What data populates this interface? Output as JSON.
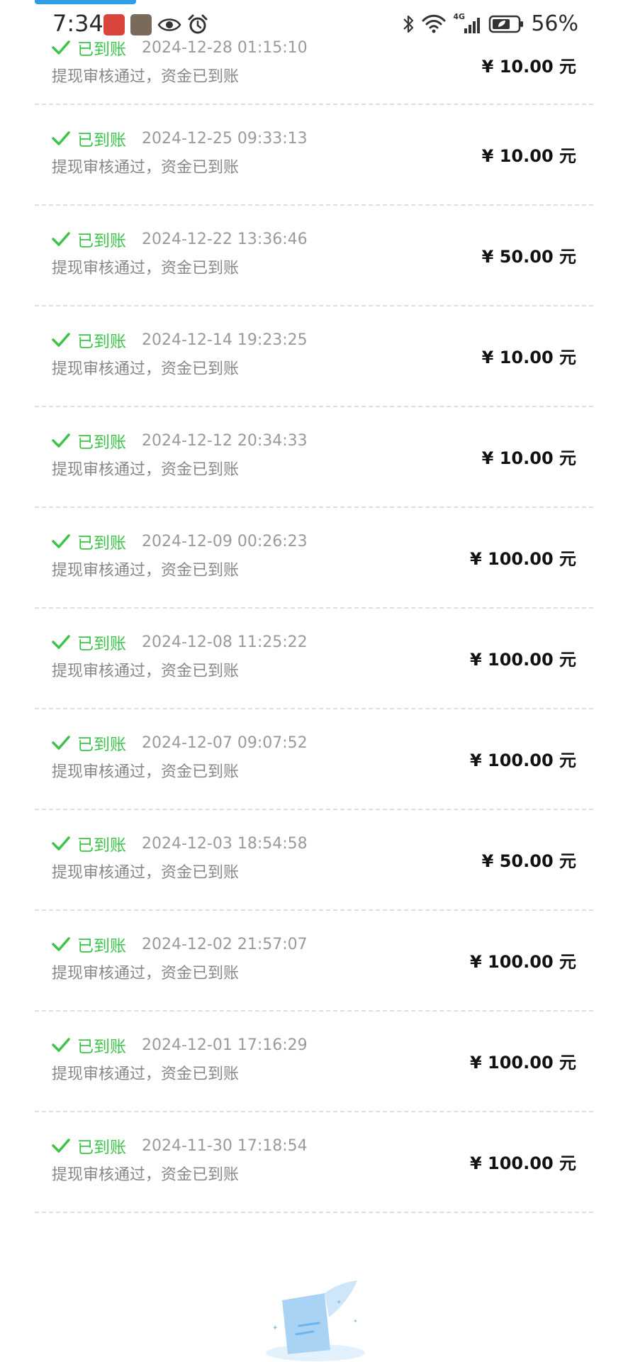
{
  "status_bar": {
    "time": "7:34",
    "battery": "56%",
    "network": "4G"
  },
  "icons": {
    "check": "checkmark-icon",
    "bluetooth": "bluetooth-icon",
    "wifi": "wifi-icon",
    "signal": "signal-icon",
    "battery": "battery-icon",
    "eye": "eye-icon",
    "alarm": "alarm-icon"
  },
  "colors": {
    "success": "#3cc34a",
    "accent": "#2f9ee8"
  },
  "records": [
    {
      "status": "已到账",
      "time": "2024-12-28 01:15:10",
      "desc": "提现审核通过，资金已到账",
      "amount": "¥ 10.00 元"
    },
    {
      "status": "已到账",
      "time": "2024-12-25 09:33:13",
      "desc": "提现审核通过，资金已到账",
      "amount": "¥ 10.00 元"
    },
    {
      "status": "已到账",
      "time": "2024-12-22 13:36:46",
      "desc": "提现审核通过，资金已到账",
      "amount": "¥ 50.00 元"
    },
    {
      "status": "已到账",
      "time": "2024-12-14 19:23:25",
      "desc": "提现审核通过，资金已到账",
      "amount": "¥ 10.00 元"
    },
    {
      "status": "已到账",
      "time": "2024-12-12 20:34:33",
      "desc": "提现审核通过，资金已到账",
      "amount": "¥ 10.00 元"
    },
    {
      "status": "已到账",
      "time": "2024-12-09 00:26:23",
      "desc": "提现审核通过，资金已到账",
      "amount": "¥ 100.00 元"
    },
    {
      "status": "已到账",
      "time": "2024-12-08 11:25:22",
      "desc": "提现审核通过，资金已到账",
      "amount": "¥ 100.00 元"
    },
    {
      "status": "已到账",
      "time": "2024-12-07 09:07:52",
      "desc": "提现审核通过，资金已到账",
      "amount": "¥ 100.00 元"
    },
    {
      "status": "已到账",
      "time": "2024-12-03 18:54:58",
      "desc": "提现审核通过，资金已到账",
      "amount": "¥ 50.00 元"
    },
    {
      "status": "已到账",
      "time": "2024-12-02 21:57:07",
      "desc": "提现审核通过，资金已到账",
      "amount": "¥ 100.00 元"
    },
    {
      "status": "已到账",
      "time": "2024-12-01 17:16:29",
      "desc": "提现审核通过，资金已到账",
      "amount": "¥ 100.00 元"
    },
    {
      "status": "已到账",
      "time": "2024-11-30 17:18:54",
      "desc": "提现审核通过，资金已到账",
      "amount": "¥ 100.00 元"
    }
  ]
}
